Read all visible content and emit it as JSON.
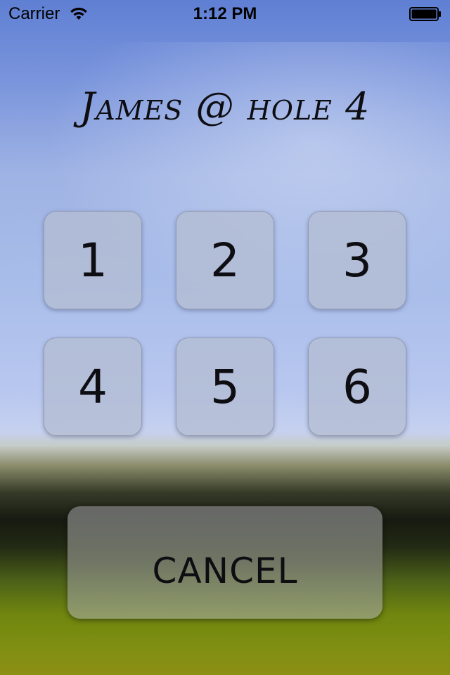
{
  "status_bar": {
    "carrier": "Carrier",
    "time": "1:12 PM",
    "wifi_icon": "wifi-icon",
    "battery_icon": "battery-icon",
    "battery_level": 1.0
  },
  "title": "James @ hole 4",
  "holes": [
    {
      "label": "1"
    },
    {
      "label": "2"
    },
    {
      "label": "3"
    },
    {
      "label": "4"
    },
    {
      "label": "5"
    },
    {
      "label": "6"
    }
  ],
  "cancel_label": "CANCEL",
  "colors": {
    "text": "#0e0e12",
    "button_fill": "#b4bcd2",
    "cancel_fill": "#6e6e6e"
  }
}
